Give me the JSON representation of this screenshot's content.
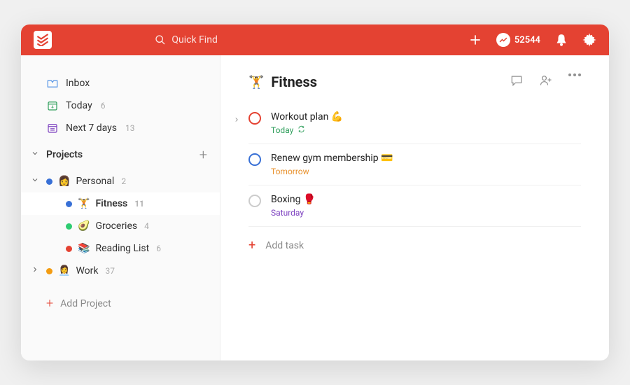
{
  "colors": {
    "brand": "#e44232",
    "blue": "#3870d6",
    "green": "#2e9e5b",
    "orange": "#e8912d",
    "purple": "#7b3fbf"
  },
  "topbar": {
    "search_placeholder": "Quick Find",
    "karma_points": "52544"
  },
  "sidebar": {
    "inbox_label": "Inbox",
    "today_label": "Today",
    "today_count": "6",
    "next7_label": "Next 7 days",
    "next7_count": "13",
    "projects_header": "Projects",
    "add_project_label": "Add Project",
    "personal": {
      "label": "Personal",
      "count": "2",
      "emoji": "👩",
      "dot": "#3870d6"
    },
    "fitness": {
      "label": "Fitness",
      "count": "11",
      "emoji": "🏋️",
      "dot": "#3870d6"
    },
    "groceries": {
      "label": "Groceries",
      "count": "4",
      "emoji": "🥑",
      "dot": "#2ecc71"
    },
    "reading": {
      "label": "Reading List",
      "count": "6",
      "emoji": "📚",
      "dot": "#e44232"
    },
    "work": {
      "label": "Work",
      "count": "37",
      "emoji": "👩‍💼",
      "dot": "#f39c12"
    }
  },
  "main": {
    "title_emoji": "🏋️",
    "title": "Fitness",
    "add_task_label": "Add task",
    "tasks": {
      "t0": {
        "title": "Workout plan 💪",
        "due": "Today",
        "due_class": "meta-today",
        "priority": "p1",
        "recurring": true,
        "expandable": true
      },
      "t1": {
        "title": "Renew gym membership 💳",
        "due": "Tomorrow",
        "due_class": "meta-tomorrow",
        "priority": "p2",
        "recurring": false,
        "expandable": false
      },
      "t2": {
        "title": "Boxing 🥊",
        "due": "Saturday",
        "due_class": "meta-sat",
        "priority": "",
        "recurring": false,
        "expandable": false
      }
    }
  }
}
